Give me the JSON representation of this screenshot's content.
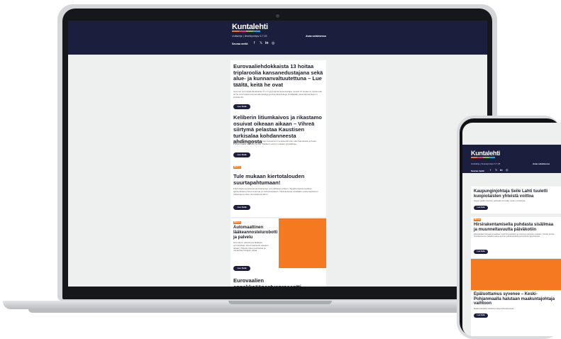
{
  "brand": {
    "logo": "Kuntalehti",
    "logo_colors": [
      "#f47920",
      "#e63b7a",
      "#8ac53f",
      "#2aa7df"
    ],
    "header_bg": "#1c1e3e",
    "accent": "#f47920"
  },
  "newsletter": {
    "subtitle": "Uutiskirje | Ilmestymispv 6.7.25",
    "open_in_browser": "Avaa selaimessa",
    "share_label": "Seuraa meitä",
    "social_icons": [
      "facebook-icon",
      "x-icon",
      "linkedin-icon",
      "instagram-icon"
    ],
    "read_more": "Lue lisää"
  },
  "laptop": {
    "articles": [
      {
        "title": "Eurovaaliehdokkaista 13 hoitaa triplaroolia kansanedustajana sekä alue- ja kunnanvaltuutettuna – Lue täältä, keitä he ovat",
        "text": "Suomen eurovaaliehdokkaista 37 on nykyisiä kansanedustajia. Heistä 13 hoitaa on triplaroolia eli he ovat lisäksi kunnanvaltuutettuja ja aluevaltuutettuja. Pelkästään aluevaltuutettuja on ehdolla 42."
      },
      {
        "title": "Keliberin litiumkaivos ja rikastamo osuivat oikeaan aikaan – Vihreä siirtymä pelastaa Kaustisen turkisalaa kohdanneesta ahdingosta",
        "text": "Keliber Oy:n litiumalan perustamat investoinnit merkitsevät sitä, että Kaustisella ja Keski-Pohjanmaalla on uutta pontta; Keliberin arvion mukaan työpaikkoja."
      },
      {
        "tag": "Mainos",
        "title": "Tule mukaan kiertotalouden suurtapahtumaan!",
        "text": "FISIT-tilaisuus kokoaa kiertotalouden ammattilaiset yhteen. Tapahtumassa kuullaan ajankohtaisia puheenvuoroja ja verkostoidutaan. Tilaisuudessa esitellään uusia käytännön ratkaisuja kuntien kiertotaloustyöhön."
      },
      {
        "tag": "Mainos",
        "title": "Automaattinen lääkeannostelurobotti ja palvelu",
        "text": "Evondosin palvelussa lääkkeet annostellaan automaattisesti oikeaan aikaan. Palvelu tukee kotihoitoa ja vapauttaa hoitajien aikaa."
      },
      {
        "title": "Eurovaalien ennakkoäänestysprosentti"
      }
    ]
  },
  "phone": {
    "articles": [
      {
        "title": "Kaupunginjohtaja Seile Lahti tuuletti kuopiolaisten yhteistä voittoa",
        "text": "Kuopio valittiin Suomen parhaaksi kunnaksi vuoden vertailussa."
      },
      {
        "tag": "Mainos",
        "title": "Hirsirakentamisella puhdasta sisäilmaa ja muunneltavuutta päiväkotiin",
        "text": "Hirsipäiväkoti tarjoaa terveellisen oppimisympäristön ja muuntuu tarpeiden mukaan. Tutustu kuinka hirsirakenteinen päiväkoti tukee kunnan palveluverkkoa ja kestävää rakentamista."
      },
      {
        "title": "Epäluottamus syvenee – Keski-Pohjanmaalla halutaan maakuntajohtaja vaihtoon",
        "text": "Maakuntahallitus käsittelee asiaa kokouksessaan."
      }
    ]
  }
}
